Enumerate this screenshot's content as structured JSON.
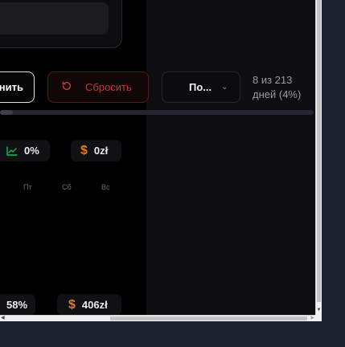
{
  "toolbar": {
    "apply_label": "нить",
    "reset_label": "Сбросить",
    "select_value": "По...",
    "progress_text": "8 из 213 дней (4%)",
    "progress_fraction": 0.04
  },
  "stats_top": {
    "growth_value": "0%",
    "money_value": "0zł"
  },
  "weekdays": [
    "Пт",
    "Сб",
    "Вс"
  ],
  "stats_bottom": {
    "percent_value": "58%",
    "money_value": "406zł"
  },
  "icons": {
    "reset": "rotate-ccw-icon",
    "select": "chevron-down-icon",
    "growth": "trend-chart-icon",
    "currency": "dollar-icon"
  },
  "colors": {
    "danger": "#c43a3a",
    "growth": "#22b35c",
    "currency": "#e0782a"
  }
}
